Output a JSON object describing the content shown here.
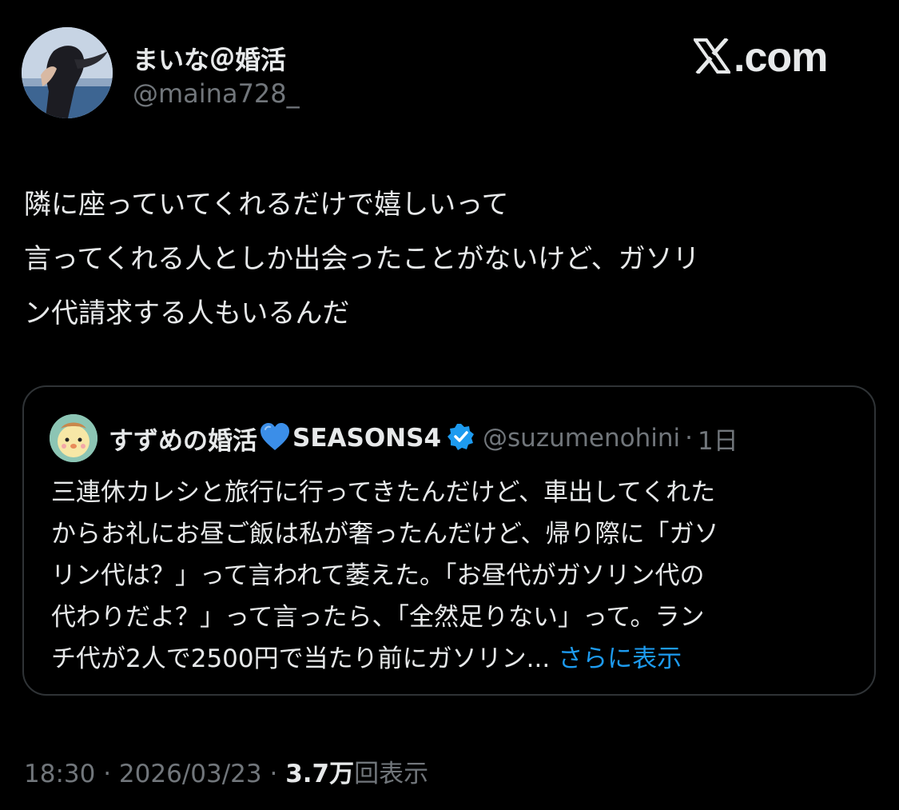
{
  "author": {
    "name": "まいな＠婚活",
    "handle": "@maina728_"
  },
  "brand": {
    "logo_text": ".com",
    "logo_icon": "x-logo-icon"
  },
  "tweet": {
    "lines": [
      "隣に座っていてくれるだけで嬉しいって",
      "言ってくれる人としか出会ったことがないけど、ガソリ",
      "ン代請求する人もいるんだ"
    ]
  },
  "quoted_tweet": {
    "name": "すずめの婚活",
    "heart_icon": "blue-heart-icon",
    "name_suffix": "SEASONS4",
    "verified_icon": "verified-badge-icon",
    "handle": "@suzumenohini",
    "separator": "·",
    "time": "1日",
    "lines": [
      "三連休カレシと旅行に行ってきたんだけど、車出してくれた",
      "からお礼にお昼ご飯は私が奢ったんだけど、帰り際に「ガソ",
      "リン代は？」って言われて萎えた。「お昼代がガソリン代の",
      "代わりだよ？」って言ったら、「全然足りない」って。ラン",
      "チ代が2人で2500円で当たり前にガソリン..."
    ],
    "show_more": "さらに表示"
  },
  "meta": {
    "time": "18:30",
    "sep1": "·",
    "date": "2026/03/23",
    "sep2": "·",
    "views_count": "3.7万",
    "views_label": "回表示"
  },
  "colors": {
    "background": "#000000",
    "text": "#e7e9ea",
    "secondary": "#71767b",
    "link": "#1d9bf0",
    "border": "#2f3336"
  }
}
